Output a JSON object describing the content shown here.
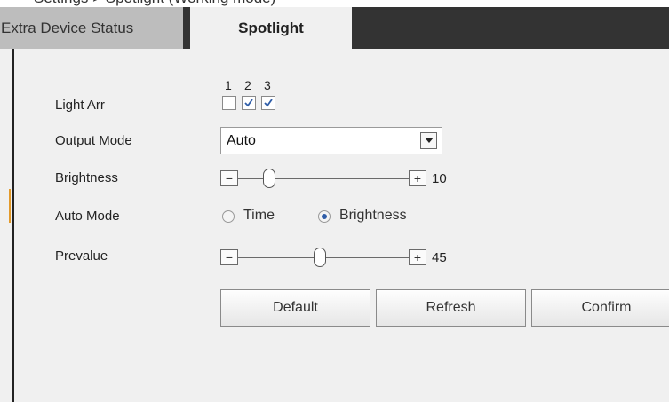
{
  "header_fragment": "Settings > Spotlight (Working mode)",
  "tabs": [
    {
      "label": "Extra Device Status",
      "selected": false
    },
    {
      "label": "Spotlight",
      "selected": true
    }
  ],
  "light_arr": {
    "label": "Light Arr",
    "items": [
      {
        "number": "1",
        "checked": false
      },
      {
        "number": "2",
        "checked": true
      },
      {
        "number": "3",
        "checked": true
      }
    ]
  },
  "output_mode": {
    "label": "Output Mode",
    "value": "Auto"
  },
  "brightness": {
    "label": "Brightness",
    "value": "10",
    "fraction": 0.1,
    "minus": "−",
    "plus": "+"
  },
  "auto_mode": {
    "label": "Auto Mode",
    "options": [
      {
        "label": "Time",
        "selected": false
      },
      {
        "label": "Brightness",
        "selected": true
      }
    ]
  },
  "prevalue": {
    "label": "Prevalue",
    "value": "45",
    "fraction": 0.45,
    "minus": "−",
    "plus": "+"
  },
  "buttons": {
    "default": "Default",
    "refresh": "Refresh",
    "confirm": "Confirm"
  },
  "colors": {
    "tabbar": "#333333",
    "panel": "#f0f0f0",
    "radio_on": "#2f5da8",
    "accent": "#e39a2a"
  }
}
